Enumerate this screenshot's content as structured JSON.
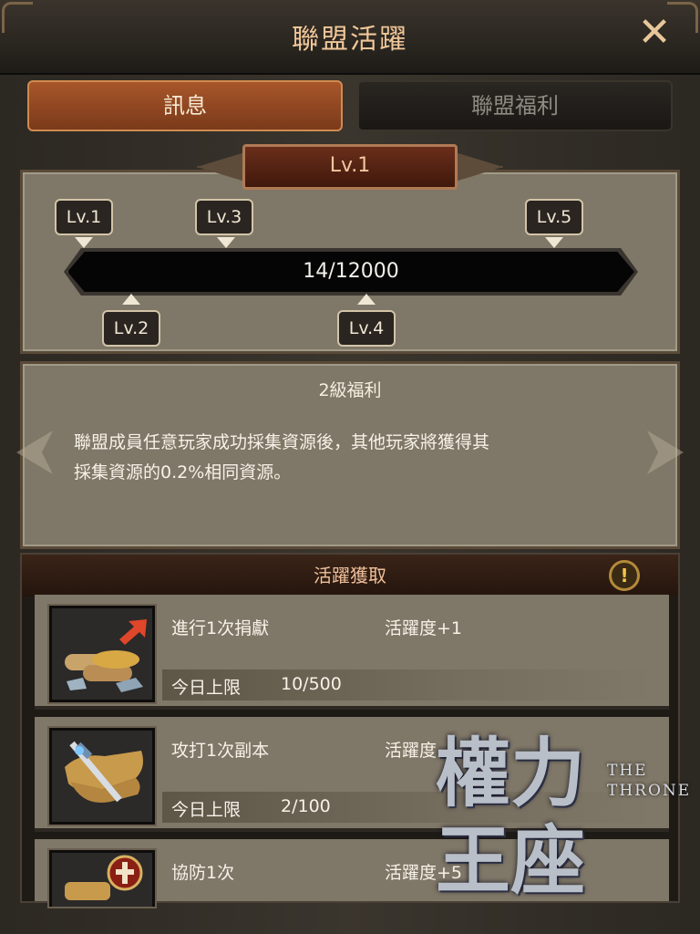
{
  "window": {
    "title": "聯盟活躍",
    "close_icon": "close-icon"
  },
  "tabs": [
    {
      "label": "訊息",
      "active": true
    },
    {
      "label": "聯盟福利",
      "active": false
    }
  ],
  "level": {
    "current_badge": "Lv.1",
    "progress_text": "14/12000",
    "progress_fraction": 0.0012,
    "markers": [
      "Lv.1",
      "Lv.2",
      "Lv.3",
      "Lv.4",
      "Lv.5"
    ]
  },
  "benefit": {
    "title": "2級福利",
    "description_line1": "聯盟成員任意玩家成功採集資源後，其他玩家將獲得其",
    "description_line2": "採集資源的0.2%相同資源。"
  },
  "activity": {
    "header": "活躍獲取",
    "info_icon": "info-icon",
    "rows": [
      {
        "name": "進行1次捐獻",
        "points": "活躍度+1",
        "limit_label": "今日上限",
        "limit_value": "10/500",
        "icon": "donation-resources-icon"
      },
      {
        "name": "攻打1次副本",
        "points": "活躍度",
        "limit_label": "今日上限",
        "limit_value": "2/100",
        "icon": "sword-scroll-icon"
      },
      {
        "name": "協防1次",
        "points": "活躍度+5",
        "icon": "defense-shield-icon"
      }
    ]
  },
  "logo": {
    "text_cn": "權力王座",
    "text_en_line1": "THE",
    "text_en_line2": "THRONE"
  },
  "colors": {
    "accent_orange": "#a8562a",
    "title_gold": "#f0c79a",
    "panel_stone": "#7f7767"
  }
}
